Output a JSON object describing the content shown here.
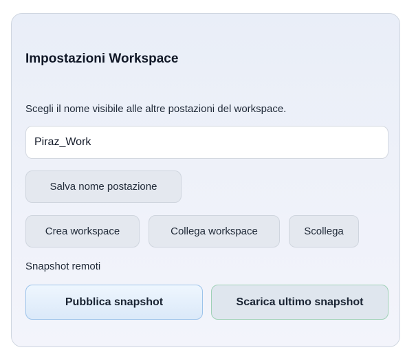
{
  "panel": {
    "title": "Impostazioni Workspace",
    "description": "Scegli il nome visibile alle altre postazioni del workspace.",
    "station_name_value": "Piraz_Work",
    "save_label": "Salva nome postazione",
    "workspace_actions": {
      "create_label": "Crea workspace",
      "connect_label": "Collega workspace",
      "disconnect_label": "Scollega"
    },
    "snapshots": {
      "section_label": "Snapshot remoti",
      "publish_label": "Pubblica snapshot",
      "download_label": "Scarica ultimo snapshot"
    }
  },
  "colors": {
    "publish_accent": "#9cc3ea",
    "download_accent": "#9fd1b6"
  }
}
